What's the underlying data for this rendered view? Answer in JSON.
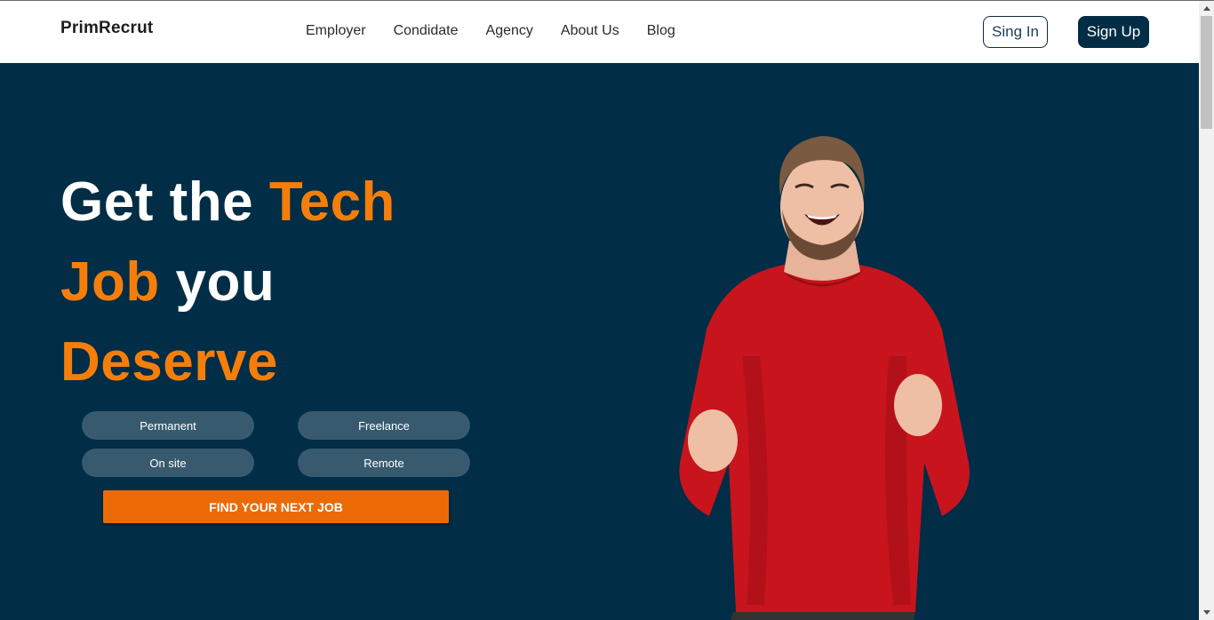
{
  "nav": {
    "logo": "PrimRecrut",
    "links": [
      "Employer",
      "Condidate",
      "Agency",
      "About Us",
      "Blog"
    ],
    "signin_label": "Sing In",
    "signup_label": "Sign Up"
  },
  "hero": {
    "headline": {
      "line1_white": "Get the ",
      "line1_accent": "Tech",
      "line2_accent": "Job",
      "line2_white": " you",
      "line3_accent": "Deserve"
    },
    "filters": {
      "permanent": "Permanent",
      "freelance": "Freelance",
      "onsite": "On site",
      "remote": "Remote"
    },
    "cta_label": "FIND YOUR NEXT JOB"
  },
  "colors": {
    "navy": "#012d46",
    "accent_orange": "#f57e0b",
    "cta_orange": "#ec6a06",
    "pill": "#375a6f"
  },
  "icons": {
    "hero_image": "excited-man-photo",
    "scroll_up": "arrow-up-icon",
    "scroll_down": "arrow-down-icon"
  }
}
